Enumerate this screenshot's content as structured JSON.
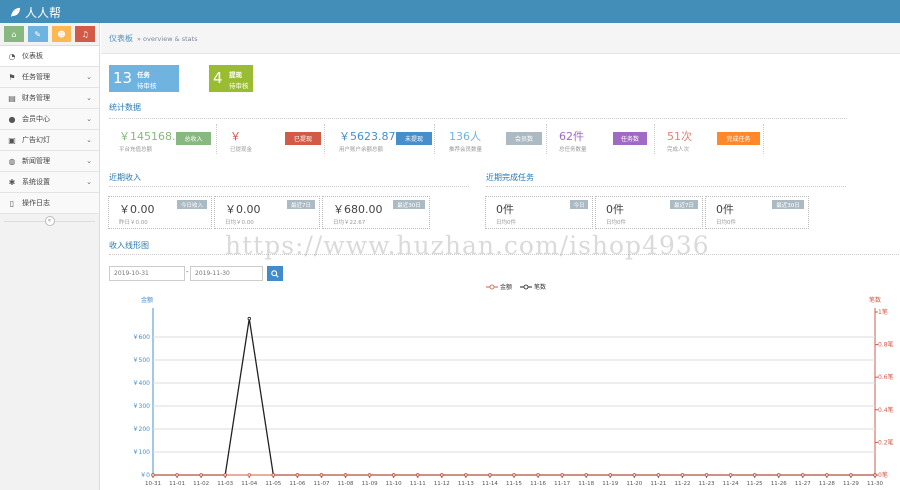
{
  "app": {
    "title": "人人帮"
  },
  "shortcuts": [
    {
      "icon": "home-icon",
      "color": "#87b87f"
    },
    {
      "icon": "pencil-icon",
      "color": "#6fb3e0"
    },
    {
      "icon": "users-icon",
      "color": "#ffb752"
    },
    {
      "icon": "bell-icon",
      "color": "#d15b47"
    }
  ],
  "menu": [
    {
      "label": "仪表板",
      "icon": "dashboard-icon",
      "glyph": "◔",
      "chevron": false
    },
    {
      "label": "任务管理",
      "icon": "flag-icon",
      "glyph": "⚑",
      "chevron": true
    },
    {
      "label": "财务管理",
      "icon": "print-icon",
      "glyph": "▤",
      "chevron": true
    },
    {
      "label": "会员中心",
      "icon": "user-icon",
      "glyph": "●",
      "chevron": true
    },
    {
      "label": "广告幻灯",
      "icon": "picture-icon",
      "glyph": "▣",
      "chevron": true
    },
    {
      "label": "新闻管理",
      "icon": "globe-icon",
      "glyph": "◍",
      "chevron": true
    },
    {
      "label": "系统设置",
      "icon": "cog-icon",
      "glyph": "✱",
      "chevron": true
    },
    {
      "label": "操作日志",
      "icon": "bookmark-icon",
      "glyph": "▯",
      "chevron": false
    }
  ],
  "breadcrumb": {
    "title": "仪表板",
    "sub": "» overview & stats"
  },
  "tiles": [
    {
      "num": "13",
      "l1": "任务",
      "l2": "待审核",
      "color": "#6fb3e0"
    },
    {
      "num": "4",
      "l1": "提现",
      "l2": "待审核",
      "color": "#9abc32"
    }
  ],
  "stats": {
    "title": "统计数据",
    "items": [
      {
        "value": "￥145168.0",
        "caption": "平台充值总额",
        "tag": "总收入",
        "value_color": "#87b87f",
        "tag_color": "#87b87f"
      },
      {
        "value": "￥",
        "caption": "已提现金",
        "tag": "已提现",
        "value_color": "#d15b47",
        "tag_color": "#d15b47"
      },
      {
        "value": "￥5623.87",
        "caption": "用户账户余额总额",
        "tag": "未提现",
        "value_color": "#478fca",
        "tag_color": "#478fca"
      },
      {
        "value": "136人",
        "caption": "推荐会员数量",
        "tag": "会员数",
        "value_color": "#6fb3e0",
        "tag_color": "#abbac3"
      },
      {
        "value": "62件",
        "caption": "总任务数量",
        "tag": "任务数",
        "value_color": "#a069c3",
        "tag_color": "#a069c3"
      },
      {
        "value": "51次",
        "caption": "完成人次",
        "tag": "完成任务",
        "value_color": "#e08374",
        "tag_color": "#ff892a"
      }
    ]
  },
  "income": {
    "title": "近期收入",
    "cards": [
      {
        "value": "￥0.00",
        "caption": "昨日￥0.00",
        "badge": "今日收入"
      },
      {
        "value": "￥0.00",
        "caption": "日均￥0.00",
        "badge": "最近7日"
      },
      {
        "value": "￥680.00",
        "caption": "日均￥22.67",
        "badge": "最近30日"
      }
    ]
  },
  "tasks": {
    "title": "近期完成任务",
    "cards": [
      {
        "value": "0件",
        "caption": "日均0件",
        "badge": "今日"
      },
      {
        "value": "0件",
        "caption": "日均0件",
        "badge": "最近7日"
      },
      {
        "value": "0件",
        "caption": "日均0件",
        "badge": "最近30日"
      }
    ]
  },
  "chart_section": {
    "title": "收入线形图",
    "start_date": "2019-10-31",
    "end_date": "2019-11-30",
    "separator": "-"
  },
  "watermark": "https://www.huzhan.com/ishop4936",
  "chart_data": {
    "type": "line",
    "x": [
      "10-31",
      "11-01",
      "11-02",
      "11-03",
      "11-04",
      "11-05",
      "11-06",
      "11-07",
      "11-08",
      "11-09",
      "11-10",
      "11-11",
      "11-12",
      "11-13",
      "11-14",
      "11-15",
      "11-16",
      "11-17",
      "11-18",
      "11-19",
      "11-20",
      "11-21",
      "11-22",
      "11-23",
      "11-24",
      "11-25",
      "11-26",
      "11-27",
      "11-28",
      "11-29",
      "11-30"
    ],
    "series": [
      {
        "name": "金额",
        "values": [
          0,
          0,
          0,
          0,
          680,
          0,
          0,
          0,
          0,
          0,
          0,
          0,
          0,
          0,
          0,
          0,
          0,
          0,
          0,
          0,
          0,
          0,
          0,
          0,
          0,
          0,
          0,
          0,
          0,
          0,
          0
        ],
        "color": "#222222"
      },
      {
        "name": "笔数",
        "values": [
          0,
          0,
          0,
          0,
          0,
          0,
          0,
          0,
          0,
          0,
          0,
          0,
          0,
          0,
          0,
          0,
          0,
          0,
          0,
          0,
          0,
          0,
          0,
          0,
          0,
          0,
          0,
          0,
          0,
          0,
          0
        ],
        "color": "#d15b47"
      }
    ],
    "y_left": {
      "label": "金额",
      "ticks": [
        "￥0",
        "￥100",
        "￥200",
        "￥300",
        "￥400",
        "￥500",
        "￥600"
      ],
      "ylim": [
        0,
        700
      ],
      "color": "#478fca"
    },
    "y_right": {
      "label": "笔数",
      "ticks": [
        "0笔",
        "0.2笔",
        "0.4笔",
        "0.6笔",
        "0.8笔",
        "1笔"
      ],
      "ylim": [
        0,
        1
      ],
      "color": "#d15b47"
    },
    "legend": [
      "金额",
      "笔数"
    ],
    "legend_position": "top-center",
    "grid": true
  }
}
